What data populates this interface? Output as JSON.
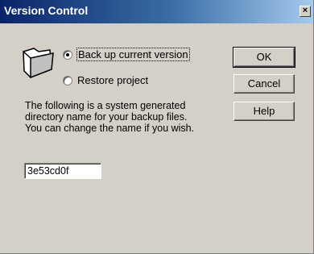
{
  "window": {
    "title": "Version Control",
    "close_glyph": "×"
  },
  "icon": {
    "name": "folder-icon"
  },
  "options": {
    "backup_label": "Back up current version",
    "restore_label": "Restore project",
    "selected": "backup"
  },
  "description": {
    "line1": "The following is a system generated",
    "line2": "directory name for your backup files.",
    "line3": "You can change the name if you wish."
  },
  "directory_name": {
    "value": "3e53cd0f"
  },
  "buttons": {
    "ok": "OK",
    "cancel": "Cancel",
    "help": "Help"
  }
}
